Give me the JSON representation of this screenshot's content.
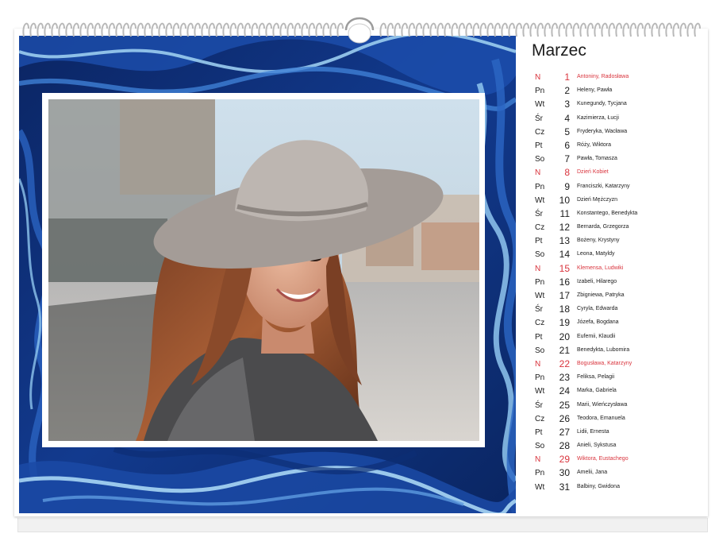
{
  "calendar": {
    "month": "Marzec",
    "colors": {
      "sunday": "#d9343d",
      "text": "#1a1a1a",
      "marble_dark": "#0c2a6e",
      "marble_mid": "#1f57b8",
      "marble_light": "#8fc5ee"
    },
    "days": [
      {
        "dow": "N",
        "num": "1",
        "names": "Antoniny, Radosława",
        "sunday": true
      },
      {
        "dow": "Pn",
        "num": "2",
        "names": "Heleny, Pawła"
      },
      {
        "dow": "Wt",
        "num": "3",
        "names": "Kunegundy, Tycjana"
      },
      {
        "dow": "Śr",
        "num": "4",
        "names": "Kazimierza, Łucji"
      },
      {
        "dow": "Cz",
        "num": "5",
        "names": "Fryderyka, Wacława"
      },
      {
        "dow": "Pt",
        "num": "6",
        "names": "Róży, Wiktora"
      },
      {
        "dow": "So",
        "num": "7",
        "names": "Pawła, Tomasza"
      },
      {
        "dow": "N",
        "num": "8",
        "names": "Dzień Kobiet",
        "sunday": true
      },
      {
        "dow": "Pn",
        "num": "9",
        "names": "Franciszki, Katarzyny"
      },
      {
        "dow": "Wt",
        "num": "10",
        "names": "Dzień Mężczyzn"
      },
      {
        "dow": "Śr",
        "num": "11",
        "names": "Konstantego, Benedykta"
      },
      {
        "dow": "Cz",
        "num": "12",
        "names": "Bernarda, Grzegorza"
      },
      {
        "dow": "Pt",
        "num": "13",
        "names": "Bożeny, Krystyny"
      },
      {
        "dow": "So",
        "num": "14",
        "names": "Leona, Matyldy"
      },
      {
        "dow": "N",
        "num": "15",
        "names": "Klemensa, Ludwiki",
        "sunday": true
      },
      {
        "dow": "Pn",
        "num": "16",
        "names": "Izabeli, Hilarego"
      },
      {
        "dow": "Wt",
        "num": "17",
        "names": "Zbigniewa, Patryka"
      },
      {
        "dow": "Śr",
        "num": "18",
        "names": "Cyryla, Edwarda"
      },
      {
        "dow": "Cz",
        "num": "19",
        "names": "Józefa, Bogdana"
      },
      {
        "dow": "Pt",
        "num": "20",
        "names": "Eufemii, Klaudii"
      },
      {
        "dow": "So",
        "num": "21",
        "names": "Benedykta, Lubomira"
      },
      {
        "dow": "N",
        "num": "22",
        "names": "Bogusława, Katarzyny",
        "sunday": true
      },
      {
        "dow": "Pn",
        "num": "23",
        "names": "Feliksa, Pelagii"
      },
      {
        "dow": "Wt",
        "num": "24",
        "names": "Marka, Gabriela"
      },
      {
        "dow": "Śr",
        "num": "25",
        "names": "Marii, Wieńczysława"
      },
      {
        "dow": "Cz",
        "num": "26",
        "names": "Teodora, Emanuela"
      },
      {
        "dow": "Pt",
        "num": "27",
        "names": "Lidii, Ernesta"
      },
      {
        "dow": "So",
        "num": "28",
        "names": "Anieli, Sykstusa"
      },
      {
        "dow": "N",
        "num": "29",
        "names": "Wiktora, Eustachego",
        "sunday": true
      },
      {
        "dow": "Pn",
        "num": "30",
        "names": "Amelii, Jana"
      },
      {
        "dow": "Wt",
        "num": "31",
        "names": "Balbiny, Gwidona"
      }
    ]
  }
}
